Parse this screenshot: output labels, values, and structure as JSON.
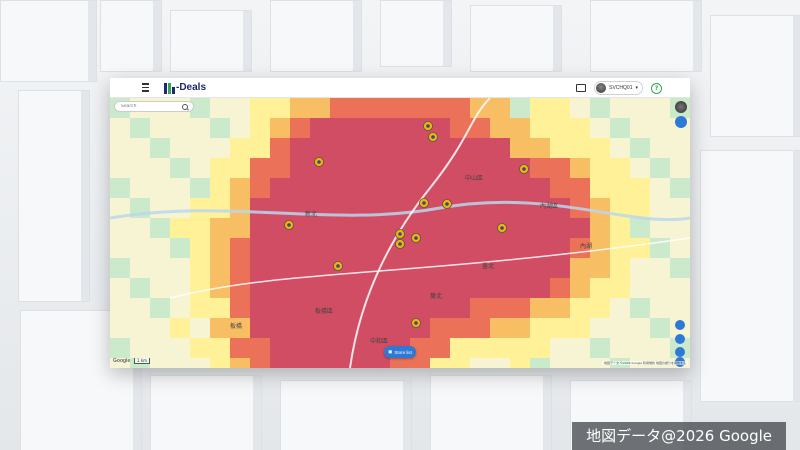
{
  "background": {
    "caption": "地図データ@2026 Google"
  },
  "app": {
    "logo_text": "-Deals",
    "user_name": "SVCHQ01",
    "help_glyph": "?"
  },
  "map": {
    "search_placeholder": "Search",
    "store_list_label": "Store list",
    "google_label": "Google",
    "scale_label": "1 km",
    "attribution": "地図データ ©2026 Google   利用規約   地図の誤りを報告する",
    "place_labels": [
      "中山區",
      "內湖區",
      "臺北",
      "板橋區",
      "新北",
      "中和區",
      "內湖",
      "板橋",
      "雙北"
    ],
    "colors": {
      "heat_low": "#fff08a",
      "heat_mid": "#f6b24a",
      "heat_high": "#e8553d",
      "heat_max": "#c8284a",
      "accent": "#2f79d6",
      "pin": "#f4b400"
    },
    "pins_count": 13
  }
}
